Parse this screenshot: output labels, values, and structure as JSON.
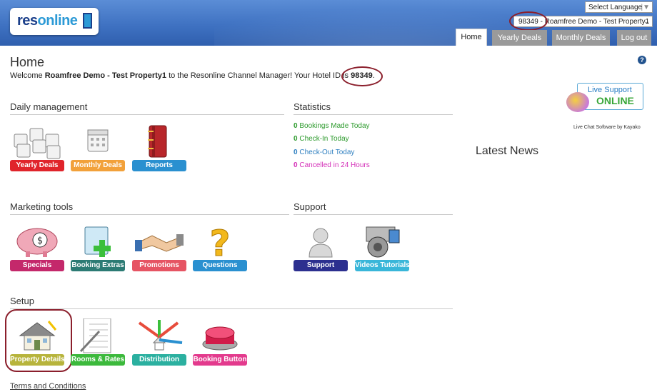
{
  "header": {
    "logo_text_a": "res",
    "logo_text_b": "online",
    "language_select": "Select Language",
    "property_select": "98349 - Roamfree Demo - Test Property1",
    "tabs": [
      "Home",
      "Yearly Deals",
      "Monthly Deals",
      "Log out"
    ]
  },
  "page": {
    "title": "Home",
    "welcome_prefix": "Welcome ",
    "welcome_name": "Roamfree Demo - Test Property1",
    "welcome_mid": " to the Resonline Channel Manager! Your Hotel ID is ",
    "hotel_id": "98349",
    "welcome_suffix": "."
  },
  "daily": {
    "title": "Daily management",
    "tiles": [
      {
        "label": "Yearly Deals",
        "color": "#e0242b",
        "icon": "calendars-icon"
      },
      {
        "label": "Monthly Deals",
        "color": "#f2a13a",
        "icon": "calendar-icon"
      },
      {
        "label": "Reports",
        "color": "#2a90d0",
        "icon": "binder-icon"
      }
    ]
  },
  "statistics": {
    "title": "Statistics",
    "items": [
      {
        "count": "0",
        "label": "Bookings Made Today",
        "color": "#2e9b2e"
      },
      {
        "count": "0",
        "label": "Check-In Today",
        "color": "#2e9b2e"
      },
      {
        "count": "0",
        "label": "Check-Out Today",
        "color": "#2e7fc0"
      },
      {
        "count": "0",
        "label": "Cancelled in 24 Hours",
        "color": "#d430b8"
      }
    ]
  },
  "marketing": {
    "title": "Marketing tools",
    "tiles": [
      {
        "label": "Specials",
        "color": "#c4286b",
        "icon": "piggy-bank-icon"
      },
      {
        "label": "Booking Extras",
        "color": "#2c7b74",
        "icon": "add-window-icon"
      },
      {
        "label": "Promotions",
        "color": "#e65463",
        "icon": "handshake-icon"
      },
      {
        "label": "Questions",
        "color": "#2a90d0",
        "icon": "question-mark-icon"
      }
    ]
  },
  "support": {
    "title": "Support",
    "tiles": [
      {
        "label": "Support",
        "color": "#2c2f8f",
        "icon": "person-icon"
      },
      {
        "label": "Videos Tutorials",
        "color": "#39b6d9",
        "icon": "speaker-icon"
      }
    ]
  },
  "setup": {
    "title": "Setup",
    "tiles": [
      {
        "label": "Property Details",
        "color": "#b7b43c",
        "icon": "house-icon"
      },
      {
        "label": "Rooms & Rates",
        "color": "#3cb93c",
        "icon": "checklist-icon"
      },
      {
        "label": "Distribution",
        "color": "#2bb0a0",
        "icon": "distribution-icon"
      },
      {
        "label": "Booking Button",
        "color": "#e33a8d",
        "icon": "red-button-icon"
      }
    ]
  },
  "sidebar": {
    "live_support_top": "Live Support",
    "live_support_bottom": "ONLINE",
    "live_caption": "Live Chat Software by Kayako",
    "latest_news": "Latest News"
  },
  "footer": {
    "terms": "Terms and Conditions"
  }
}
